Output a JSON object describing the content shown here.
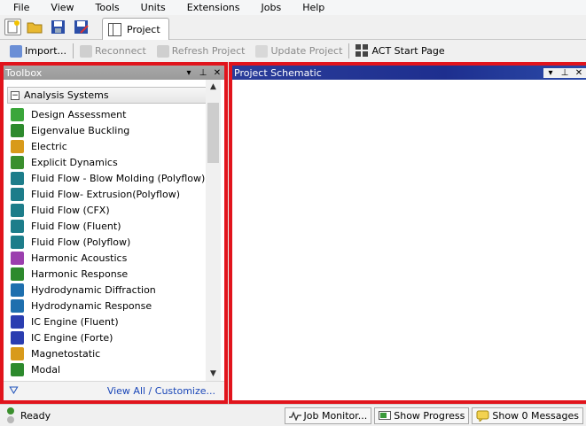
{
  "menu": [
    "File",
    "View",
    "Tools",
    "Units",
    "Extensions",
    "Jobs",
    "Help"
  ],
  "tab": {
    "label": "Project"
  },
  "toolbar": {
    "import": "Import...",
    "reconnect": "Reconnect",
    "refresh": "Refresh Project",
    "update": "Update Project",
    "act": "ACT Start Page"
  },
  "toolbox": {
    "title": "Toolbox",
    "group": "Analysis Systems",
    "items": [
      {
        "label": "Design Assessment",
        "icon": "check-icon",
        "color": "#3aa63a"
      },
      {
        "label": "Eigenvalue Buckling",
        "icon": "buckling-icon",
        "color": "#2d8a2d"
      },
      {
        "label": "Electric",
        "icon": "electric-icon",
        "color": "#d89a1a"
      },
      {
        "label": "Explicit Dynamics",
        "icon": "explicit-icon",
        "color": "#3a8f2d"
      },
      {
        "label": "Fluid Flow - Blow Molding (Polyflow)",
        "icon": "polyflow-icon",
        "color": "#1d7d8a"
      },
      {
        "label": "Fluid Flow- Extrusion(Polyflow)",
        "icon": "polyflow-icon",
        "color": "#1d7d8a"
      },
      {
        "label": "Fluid Flow (CFX)",
        "icon": "cfx-icon",
        "color": "#1d7d8a"
      },
      {
        "label": "Fluid Flow (Fluent)",
        "icon": "fluent-icon",
        "color": "#1d7d8a"
      },
      {
        "label": "Fluid Flow (Polyflow)",
        "icon": "polyflow-icon",
        "color": "#1d7d8a"
      },
      {
        "label": "Harmonic Acoustics",
        "icon": "acoustics-icon",
        "color": "#9b3fae"
      },
      {
        "label": "Harmonic Response",
        "icon": "harmonic-icon",
        "color": "#2d8a2d"
      },
      {
        "label": "Hydrodynamic Diffraction",
        "icon": "diffraction-icon",
        "color": "#1e6fae"
      },
      {
        "label": "Hydrodynamic Response",
        "icon": "hydro-response-icon",
        "color": "#1e6fae"
      },
      {
        "label": "IC Engine (Fluent)",
        "icon": "engine-icon",
        "color": "#2a3db0"
      },
      {
        "label": "IC Engine (Forte)",
        "icon": "engine-icon",
        "color": "#2a3db0"
      },
      {
        "label": "Magnetostatic",
        "icon": "magnet-icon",
        "color": "#d89a1a"
      },
      {
        "label": "Modal",
        "icon": "modal-icon",
        "color": "#2d8a2d"
      }
    ],
    "footer_link": "View All / Customize..."
  },
  "schematic": {
    "title": "Project Schematic"
  },
  "status": {
    "ready": "Ready",
    "job_monitor": "Job Monitor...",
    "show_progress": "Show Progress",
    "show_messages": "Show 0 Messages"
  }
}
